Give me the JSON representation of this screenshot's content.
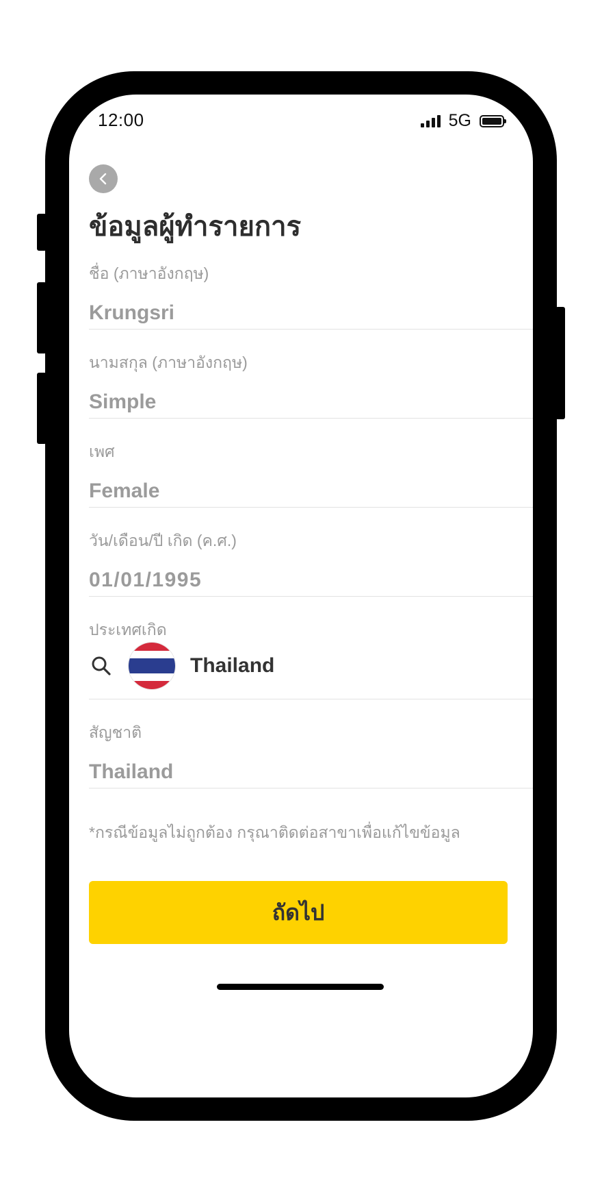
{
  "status_bar": {
    "time": "12:00",
    "network": "5G"
  },
  "header": {
    "title": "ข้อมูลผู้ทำรายการ"
  },
  "form": {
    "first_name": {
      "label": "ชื่อ (ภาษาอังกฤษ)",
      "value": "Krungsri"
    },
    "last_name": {
      "label": "นามสกุล (ภาษาอังกฤษ)",
      "value": "Simple"
    },
    "gender": {
      "label": "เพศ",
      "value": "Female"
    },
    "birth_date": {
      "label": "วัน/เดือน/ปี เกิด (ค.ศ.)",
      "value": "01/01/1995"
    },
    "birth_country": {
      "label": "ประเทศเกิด",
      "value": "Thailand",
      "flag_icon": "thailand-flag-icon"
    },
    "nationality": {
      "label": "สัญชาติ",
      "value": "Thailand"
    }
  },
  "note": "*กรณีข้อมูลไม่ถูกต้อง กรุณาติดต่อสาขาเพื่อแก้ไขข้อมูล",
  "next_button": {
    "label": "ถัดไป"
  },
  "colors": {
    "accent": "#fed200",
    "back_button_bg": "#a9a9a9",
    "value_text": "#9b9b9b",
    "title_text": "#2e2e2e",
    "flag_red": "#d42a3c",
    "flag_white": "#ffffff",
    "flag_blue": "#2a3d8f"
  }
}
